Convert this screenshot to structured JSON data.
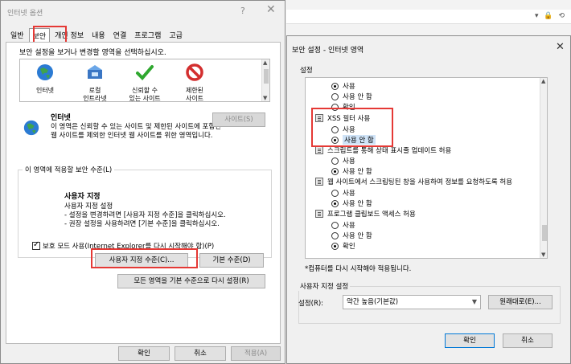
{
  "browser": {
    "address_icons": "▾ 🔒 ⟲"
  },
  "internet_options": {
    "title": "인터넷 옵션",
    "help": "?",
    "close": "✕",
    "tabs": [
      "일반",
      "보안",
      "개인 정보",
      "내용",
      "연결",
      "프로그램",
      "고급"
    ],
    "active_tab": "보안",
    "zone_instruction": "보안 설정을 보거나 변경할 영역을 선택하십시오.",
    "zones": [
      {
        "label1": "인터넷",
        "label2": ""
      },
      {
        "label1": "로컬",
        "label2": "인트라넷"
      },
      {
        "label1": "신뢰할 수",
        "label2": "있는 사이트"
      },
      {
        "label1": "제한된",
        "label2": "사이트"
      }
    ],
    "zone_detail_title": "인터넷",
    "zone_detail_desc": "이 영역은 신뢰할 수 있는 사이트 및 제한된 사이트에 포함된 웹 사이트를 제외한 인터넷 웹 사이트를 위한 영역입니다.",
    "sites_button": "사이트(S)",
    "security_level_label": "이 영역에 적용할 보안 수준(L)",
    "custom_title": "사용자 지정",
    "custom_desc": [
      "사용자 지정 설정",
      "- 설정을 변경하려면 [사용자 지정 수준]을 클릭하십시오.",
      "- 권장 설정을 사용하려면 [기본 수준]을 클릭하십시오."
    ],
    "protected_mode": "보호 모드 사용(Internet Explorer를 다시 시작해야 함)(P)",
    "custom_level_button": "사용자 지정 수준(C)...",
    "default_level_button": "기본 수준(D)",
    "reset_all_button": "모든 영역을 기본 수준으로 다시 설정(R)",
    "ok": "확인",
    "cancel": "취소",
    "apply": "적용(A)"
  },
  "security_settings": {
    "title": "보안 설정 - 인터넷 영역",
    "close": "✕",
    "settings_label": "설정",
    "rows": [
      {
        "kind": "radio",
        "text": "사용",
        "checked": true
      },
      {
        "kind": "radio",
        "text": "사용 안 함",
        "checked": false
      },
      {
        "kind": "radio",
        "text": "확인",
        "checked": false
      },
      {
        "kind": "header",
        "text": "XSS 필터 사용"
      },
      {
        "kind": "radio",
        "text": "사용",
        "checked": false
      },
      {
        "kind": "radio",
        "text": "사용 안 함",
        "checked": true
      },
      {
        "kind": "header",
        "text": "스크립트를 통해 상태 표시줄 업데이트 허용"
      },
      {
        "kind": "radio",
        "text": "사용",
        "checked": false
      },
      {
        "kind": "radio",
        "text": "사용 안 함",
        "checked": true
      },
      {
        "kind": "header",
        "text": "웹 사이트에서 스크립팅된 창을 사용하여 정보를 요청하도록 허용"
      },
      {
        "kind": "radio",
        "text": "사용",
        "checked": false
      },
      {
        "kind": "radio",
        "text": "사용 안 함",
        "checked": true
      },
      {
        "kind": "header",
        "text": "프로그램 클립보드 액세스 허용"
      },
      {
        "kind": "radio",
        "text": "사용",
        "checked": false
      },
      {
        "kind": "radio",
        "text": "사용 안 함",
        "checked": false
      },
      {
        "kind": "radio",
        "text": "확인",
        "checked": true
      }
    ],
    "restart_note": "*컴퓨터를 다시 시작해야 적용됩니다.",
    "custom_group_label": "사용자 지정 설정",
    "reset_to_label": "설정(R):",
    "reset_to_value": "약간 높음(기본값)",
    "reset_button": "원래대로(E)...",
    "ok": "확인",
    "cancel": "취소"
  }
}
